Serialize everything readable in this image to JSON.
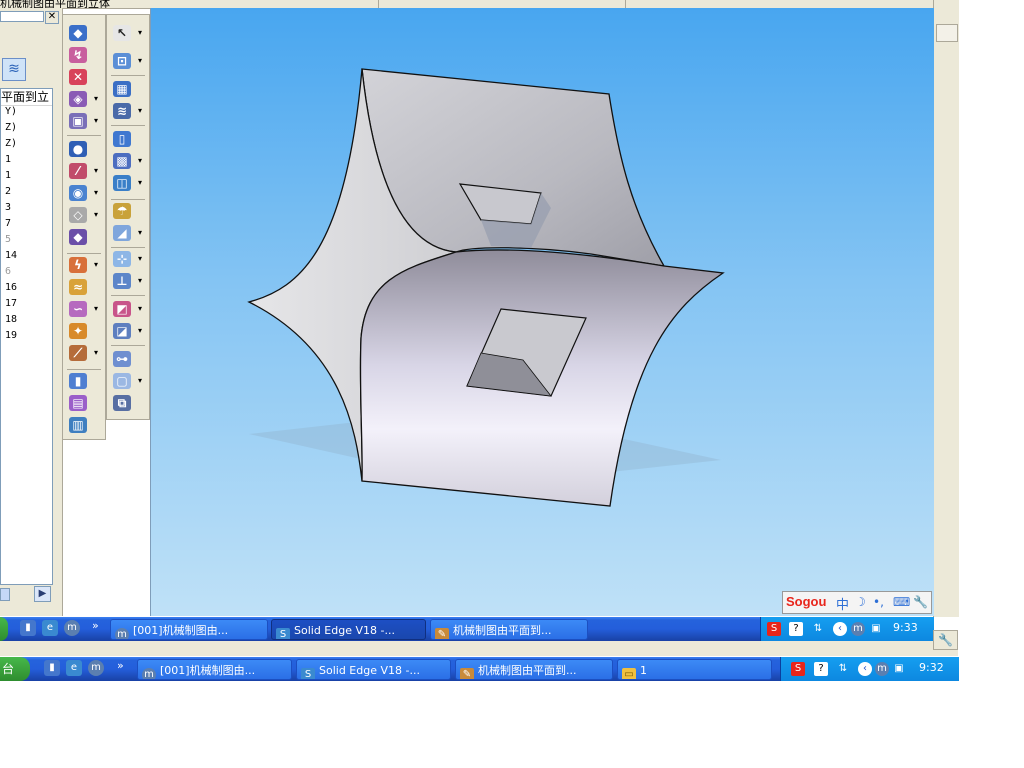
{
  "window": {
    "top_title": "机械制图由平面到立体"
  },
  "left_panel": {
    "list_header": "平面到立",
    "list_items": [
      "Y)",
      "Z)",
      "Z)",
      "1",
      "1",
      "2",
      "3",
      "7",
      "5",
      "14",
      "6",
      "16",
      "17",
      "18",
      "19"
    ],
    "dimmed_items": [
      "5",
      "6"
    ],
    "scroll_arrow": "▶",
    "close_glyph": "✕"
  },
  "toolbar_left": {
    "icons": [
      "revolve-protrusion-icon",
      "swept-icon",
      "cutout-icon",
      "lofted-icon",
      "thin-wall-icon",
      "hole-icon",
      "rib-icon",
      "web-network-icon",
      "draft-icon",
      "thicken-icon",
      "curve-icon",
      "helix-icon",
      "project-curve-icon",
      "intersect-icon",
      "split-icon",
      "offset-surface-icon",
      "copy-surface-icon",
      "stitch-icon",
      "parts-library-icon"
    ]
  },
  "toolbar_right": {
    "icons": [
      "select-tool-icon",
      "sketch-icon",
      "view-cube-icon",
      "pattern-icon",
      "plane-icon",
      "multi-plane-icon",
      "coordinate-icon",
      "bluedot-icon",
      "surface-icon",
      "rib-network-icon",
      "normal-icon",
      "blend-icon",
      "round-icon",
      "parametric-icon",
      "face-icon",
      "mirror-icon"
    ]
  },
  "viewport": {
    "model": "swept-surface-model"
  },
  "ime": {
    "logo": "Sogou",
    "mode": "中",
    "symbols": [
      "☽",
      "•,",
      "⌨",
      "🔧"
    ]
  },
  "taskbars": [
    {
      "start_label": "",
      "tasks": [
        {
          "label": "[001]机械制图由...",
          "icon": "m-browser-icon",
          "active": false
        },
        {
          "label": "Solid Edge V18 -...",
          "icon": "solid-edge-icon",
          "active": true
        },
        {
          "label": "机械制图由平面到...",
          "icon": "paint-icon",
          "active": false
        }
      ],
      "clock": "9:33"
    },
    {
      "start_label": "台",
      "tasks": [
        {
          "label": "[001]机械制图由...",
          "icon": "m-browser-icon",
          "active": false
        },
        {
          "label": "Solid Edge V18 -...",
          "icon": "solid-edge-icon",
          "active": false
        },
        {
          "label": "机械制图由平面到...",
          "icon": "paint-icon",
          "active": false
        },
        {
          "label": "1",
          "icon": "folder-icon",
          "active": false
        }
      ],
      "clock": "9:32"
    }
  ],
  "quick_launch_more": "»",
  "colors": {
    "viewport_top": "#48a6f0",
    "viewport_bottom": "#bfe1f7",
    "taskbar_blue": "#245edb",
    "tray_blue": "#0d88e0",
    "start_green": "#2e8d2f",
    "sogou_red": "#e8251b"
  }
}
